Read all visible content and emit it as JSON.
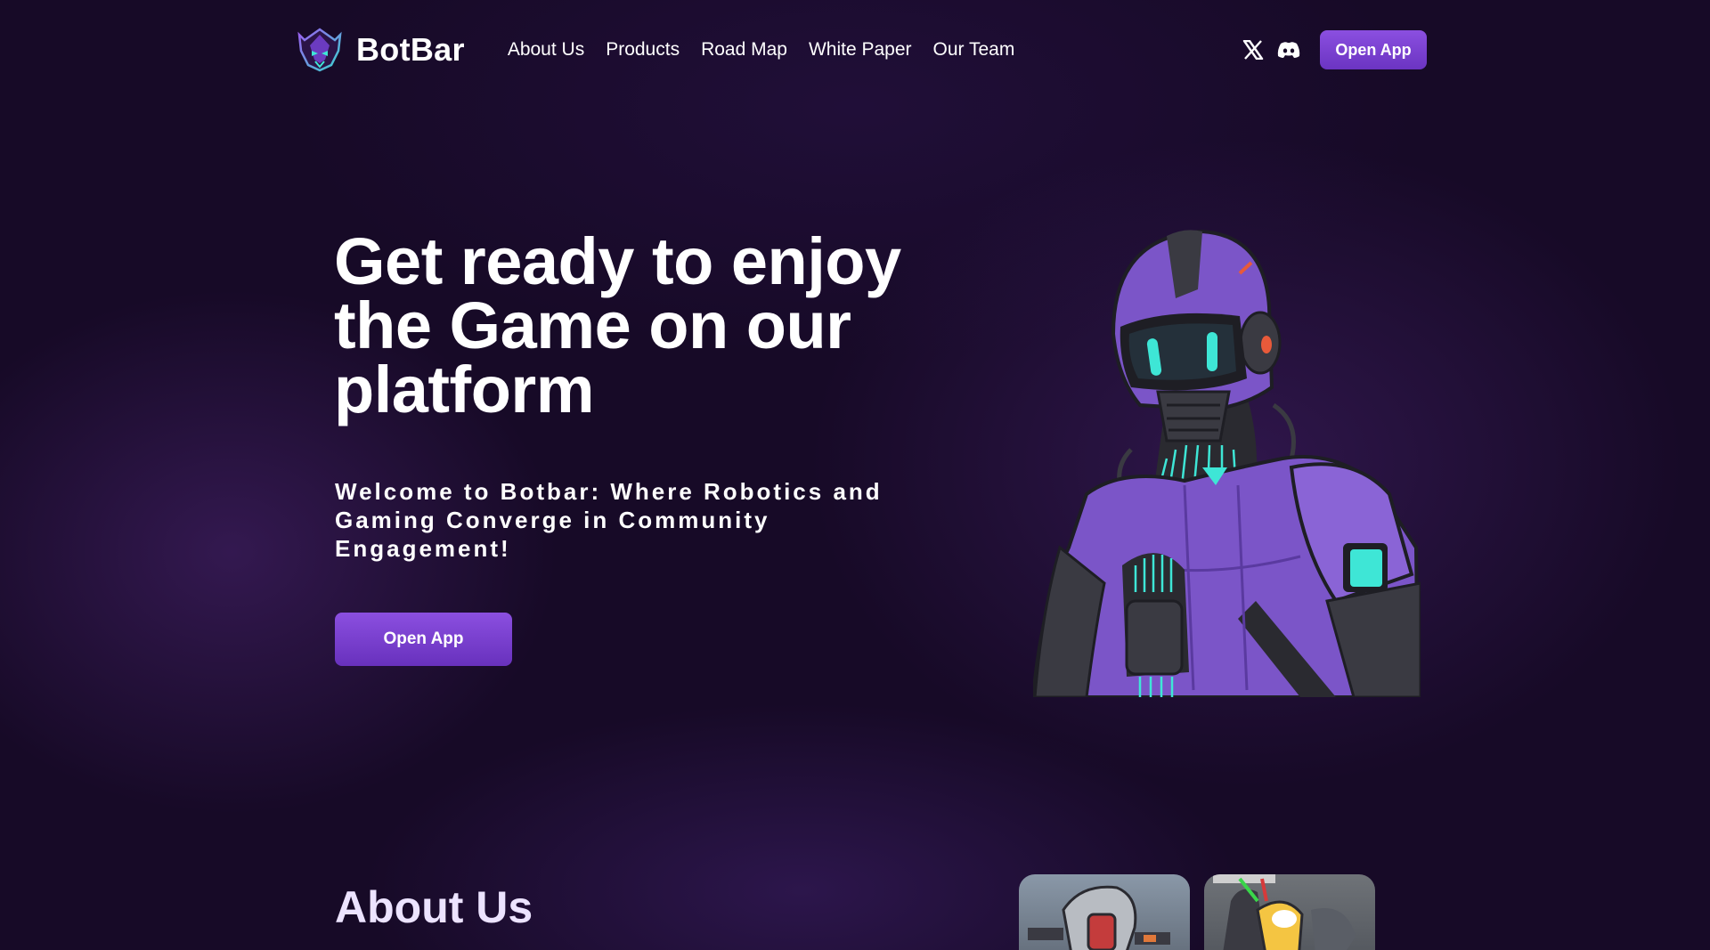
{
  "header": {
    "brand_name": "BotBar",
    "nav": [
      {
        "label": "About Us"
      },
      {
        "label": "Products"
      },
      {
        "label": "Road Map"
      },
      {
        "label": "White Paper"
      },
      {
        "label": "Our Team"
      }
    ],
    "social": [
      {
        "icon": "x-twitter-icon"
      },
      {
        "icon": "discord-icon"
      }
    ],
    "cta_label": "Open App"
  },
  "hero": {
    "title": "Get ready to enjoy the Game on our platform",
    "subtitle": "Welcome to Botbar: Where Robotics and Gaming Converge in Community Engagement!",
    "cta_label": "Open App"
  },
  "about": {
    "title": "About Us"
  },
  "colors": {
    "background": "#170a27",
    "accent": "#7a40d6",
    "robot_purple": "#7b55c8",
    "robot_cyan": "#3ee6d6"
  }
}
